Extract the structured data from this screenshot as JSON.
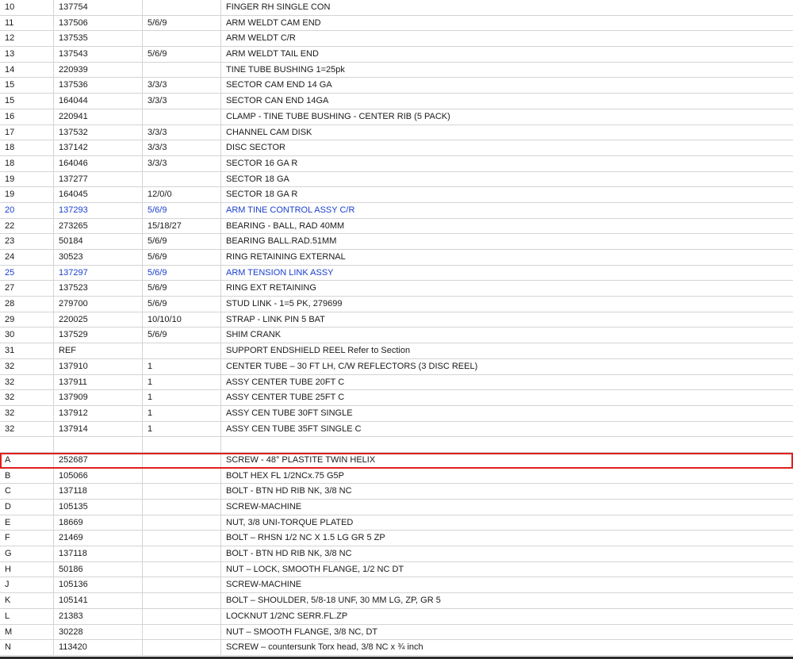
{
  "table": {
    "rows": [
      [
        "10",
        "137754",
        "",
        "FINGER RH SINGLE CON"
      ],
      [
        "11",
        "137506",
        "5/6/9",
        "ARM WELDT CAM END"
      ],
      [
        "12",
        "137535",
        "",
        "ARM WELDT C/R"
      ],
      [
        "13",
        "137543",
        "5/6/9",
        "ARM WELDT TAIL END"
      ],
      [
        "14",
        "220939",
        "",
        "TINE TUBE BUSHING 1=25pk"
      ],
      [
        "15",
        "137536",
        "3/3/3",
        "SECTOR CAM END 14 GA"
      ],
      [
        "15",
        "164044",
        "3/3/3",
        "SECTOR CAN END 14GA"
      ],
      [
        "16",
        "220941",
        "",
        "CLAMP - TINE TUBE BUSHING - CENTER RIB (5 PACK)"
      ],
      [
        "17",
        "137532",
        "3/3/3",
        "CHANNEL CAM DISK"
      ],
      [
        "18",
        "137142",
        "3/3/3",
        "DISC SECTOR"
      ],
      [
        "18",
        "164046",
        "3/3/3",
        "SECTOR 16 GA R"
      ],
      [
        "19",
        "137277",
        "",
        "SECTOR 18 GA"
      ],
      [
        "19",
        "164045",
        "12/0/0",
        "SECTOR 18 GA R"
      ],
      [
        "20",
        "137293",
        "5/6/9",
        "ARM TINE CONTROL ASSY C/R"
      ],
      [
        "22",
        "273265",
        "15/18/27",
        "BEARING - BALL, RAD 40MM"
      ],
      [
        "23",
        "50184",
        "5/6/9",
        "BEARING BALL.RAD.51MM"
      ],
      [
        "24",
        "30523",
        "5/6/9",
        "RING RETAINING EXTERNAL"
      ],
      [
        "25",
        "137297",
        "5/6/9",
        "ARM TENSION LINK ASSY"
      ],
      [
        "27",
        "137523",
        "5/6/9",
        "RING EXT RETAINING"
      ],
      [
        "28",
        "279700",
        "5/6/9",
        "STUD LINK - 1=5 PK, 279699"
      ],
      [
        "29",
        "220025",
        "10/10/10",
        "STRAP - LINK PIN 5 BAT"
      ],
      [
        "30",
        "137529",
        "5/6/9",
        "SHIM CRANK"
      ],
      [
        "31",
        "REF",
        "",
        "SUPPORT ENDSHIELD REEL Refer to Section"
      ],
      [
        "32",
        "137910",
        "1",
        "CENTER TUBE – 30 FT LH, C/W REFLECTORS (3 DISC REEL)"
      ],
      [
        "32",
        "137911",
        "1",
        "ASSY CENTER TUBE 20FT C"
      ],
      [
        "32",
        "137909",
        "1",
        "ASSY CENTER TUBE 25FT C"
      ],
      [
        "32",
        "137912",
        "1",
        "ASSY CEN TUBE 30FT SINGLE"
      ],
      [
        "32",
        "137914",
        "1",
        "ASSY CEN TUBE 35FT SINGLE C"
      ],
      [
        "",
        "",
        "",
        ""
      ],
      [
        "A",
        "252687",
        "",
        "SCREW - 48° PLASTITE TWIN HELIX"
      ],
      [
        "B",
        "105066",
        "",
        "BOLT HEX FL 1/2NCx.75 G5P"
      ],
      [
        "C",
        "137118",
        "",
        "BOLT - BTN HD RIB NK, 3/8 NC"
      ],
      [
        "D",
        "105135",
        "",
        "SCREW-MACHINE"
      ],
      [
        "E",
        "18669",
        "",
        "NUT, 3/8 UNI-TORQUE PLATED"
      ],
      [
        "F",
        "21469",
        "",
        "BOLT – RHSN 1/2 NC X 1.5 LG GR 5 ZP"
      ],
      [
        "G",
        "137118",
        "",
        "BOLT - BTN HD RIB NK, 3/8 NC"
      ],
      [
        "H",
        "50186",
        "",
        "NUT – LOCK, SMOOTH FLANGE, 1/2 NC DT"
      ],
      [
        "J",
        "105136",
        "",
        "SCREW-MACHINE"
      ],
      [
        "K",
        "105141",
        "",
        "BOLT – SHOULDER, 5/8-18 UNF, 30 MM LG, ZP, GR 5"
      ],
      [
        "L",
        "21383",
        "",
        "LOCKNUT 1/2NC SERR.FL.ZP"
      ],
      [
        "M",
        "30228",
        "",
        "NUT – SMOOTH FLANGE, 3/8 NC, DT"
      ],
      [
        "N",
        "113420",
        "",
        "SCREW – countersunk Torx head, 3/8 NC x ¾ inch"
      ]
    ],
    "link_row_indices": [
      13,
      17
    ],
    "selected_row_index": 29,
    "link_color": "#1a3fcf",
    "selection_border_color": "#e02020"
  }
}
